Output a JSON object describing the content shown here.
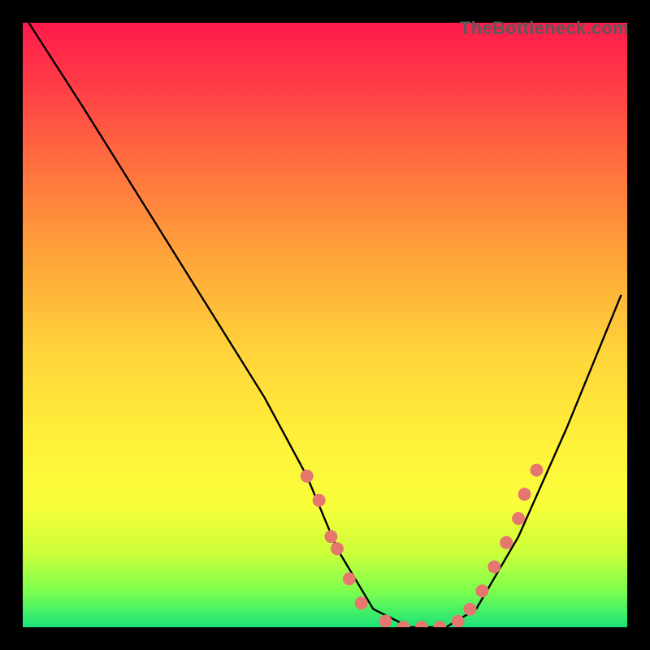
{
  "watermark": "TheBottleneck.com",
  "chart_data": {
    "type": "line",
    "title": "",
    "xlabel": "",
    "ylabel": "",
    "xlim": [
      0,
      100
    ],
    "ylim": [
      0,
      100
    ],
    "grid": false,
    "legend": false,
    "series": [
      {
        "name": "curve",
        "x": [
          1,
          10,
          20,
          30,
          40,
          47,
          52,
          58,
          64,
          70,
          75,
          82,
          90,
          99
        ],
        "y": [
          100,
          86,
          70,
          54,
          38,
          25,
          13,
          3,
          0,
          0,
          3,
          15,
          33,
          55
        ]
      }
    ],
    "markers": {
      "name": "highlight-dots",
      "color": "#e6776f",
      "points": [
        {
          "x": 47,
          "y": 25
        },
        {
          "x": 49,
          "y": 21
        },
        {
          "x": 51,
          "y": 15
        },
        {
          "x": 52,
          "y": 13
        },
        {
          "x": 54,
          "y": 8
        },
        {
          "x": 56,
          "y": 4
        },
        {
          "x": 60,
          "y": 1
        },
        {
          "x": 63,
          "y": 0
        },
        {
          "x": 66,
          "y": 0
        },
        {
          "x": 69,
          "y": 0
        },
        {
          "x": 72,
          "y": 1
        },
        {
          "x": 74,
          "y": 3
        },
        {
          "x": 76,
          "y": 6
        },
        {
          "x": 78,
          "y": 10
        },
        {
          "x": 80,
          "y": 14
        },
        {
          "x": 82,
          "y": 18
        },
        {
          "x": 83,
          "y": 22
        },
        {
          "x": 85,
          "y": 26
        }
      ]
    }
  }
}
